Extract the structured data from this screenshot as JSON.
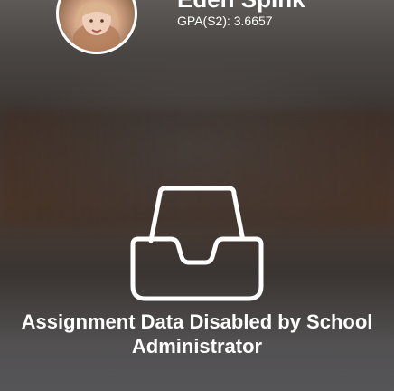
{
  "student": {
    "name": "Eden Spink",
    "gpa": "GPA(S2): 3.6657"
  },
  "empty_state": {
    "icon": "inbox-tray-icon",
    "message": "Assignment Data Disabled by School Administrator"
  },
  "colors": {
    "text": "#ffffff",
    "background": "#3a3532"
  }
}
